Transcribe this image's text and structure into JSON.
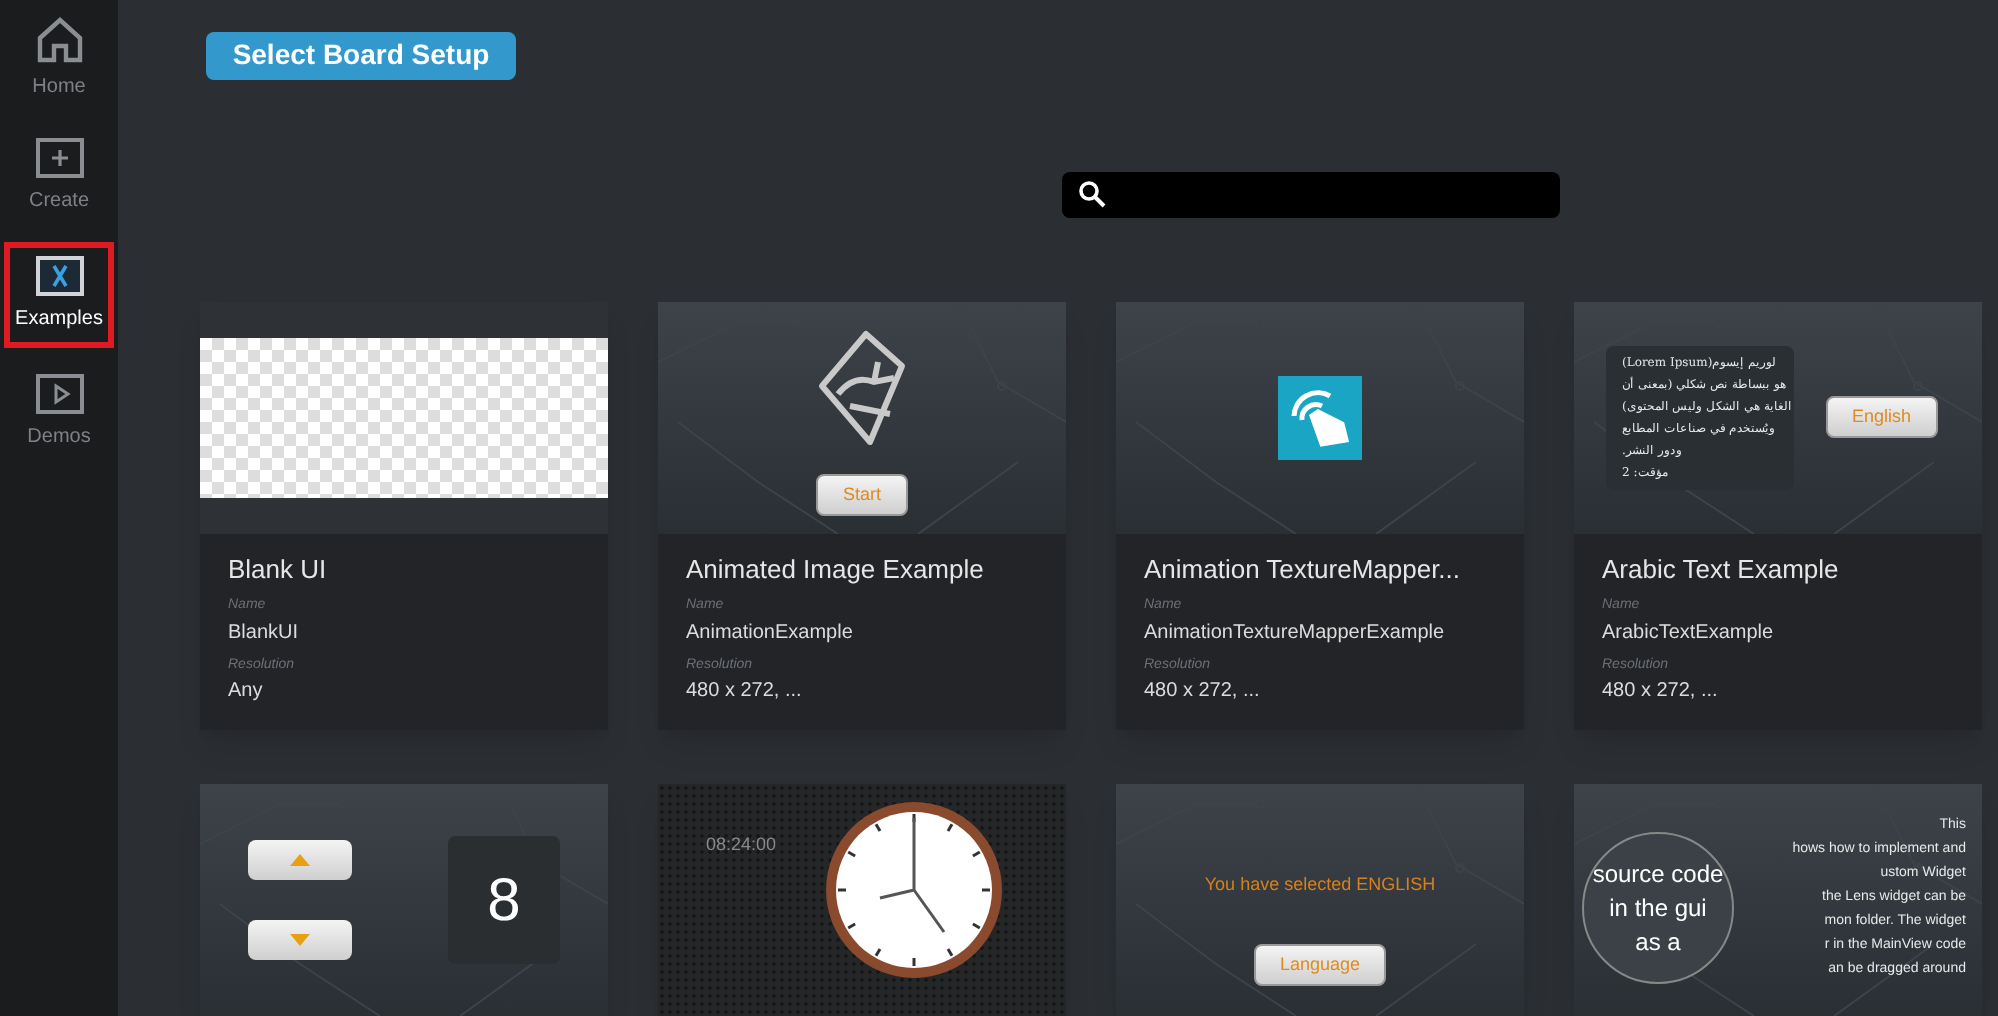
{
  "sidebar": {
    "items": [
      {
        "label": "Home",
        "kind": "home",
        "selected": false
      },
      {
        "label": "Create",
        "kind": "create",
        "selected": false
      },
      {
        "label": "Examples",
        "kind": "examples",
        "selected": true
      },
      {
        "label": "Demos",
        "kind": "demos",
        "selected": false
      }
    ]
  },
  "select_board_button": "Select Board Setup",
  "cards": [
    {
      "kind": "blank",
      "title": "Blank UI",
      "name_label": "Name",
      "name": "BlankUI",
      "resolution_label": "Resolution",
      "resolution": "Any"
    },
    {
      "kind": "animated",
      "title": "Animated Image Example",
      "name_label": "Name",
      "name": "AnimationExample",
      "resolution_label": "Resolution",
      "resolution": "480 x 272, ...",
      "button": "Start"
    },
    {
      "kind": "texture",
      "title": "Animation TextureMapper...",
      "name_label": "Name",
      "name": "AnimationTextureMapperExample",
      "resolution_label": "Resolution",
      "resolution": "480 x 272, ..."
    },
    {
      "kind": "arabic",
      "title": "Arabic Text Example",
      "name_label": "Name",
      "name": "ArabicTextExample",
      "resolution_label": "Resolution",
      "resolution": "480 x 272, ...",
      "button": "English",
      "lines": [
        "لوريم إيسوم(Lorem Ipsum)",
        "هو ببساطة نص شكلي (بمعنى أن",
        "الغاية هي الشكل وليس المحتوى)",
        "ويُستخدم في صناعات المطابع",
        "ودور النشر.",
        "مؤقت: 2"
      ]
    },
    {
      "kind": "counter",
      "value": "8"
    },
    {
      "kind": "clock",
      "time": "08:24:00"
    },
    {
      "kind": "language",
      "message": "You have selected ENGLISH",
      "button": "Language"
    },
    {
      "kind": "lens",
      "lines": [
        "This",
        "hows how to implement and",
        "ustom Widget",
        "the Lens widget  can be",
        "mon folder. The widget",
        "r in the MainView code",
        "an be dragged around"
      ],
      "lens_lines": [
        "source code",
        "in the gui",
        "as a"
      ]
    }
  ]
}
